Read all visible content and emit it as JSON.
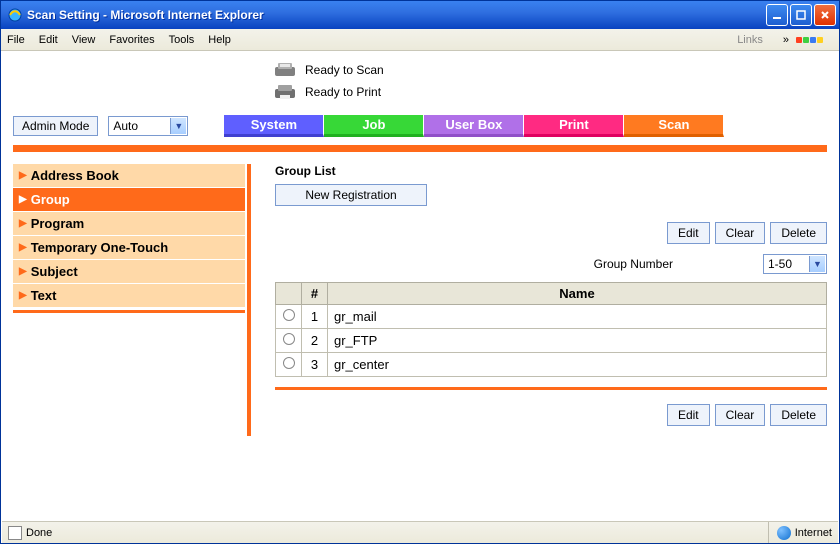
{
  "window": {
    "title": "Scan Setting - Microsoft Internet Explorer"
  },
  "menu": {
    "items": [
      "File",
      "Edit",
      "View",
      "Favorites",
      "Tools",
      "Help"
    ],
    "links_label": "Links"
  },
  "status_lines": {
    "scan": "Ready to Scan",
    "print": "Ready to Print"
  },
  "controls": {
    "admin_mode": "Admin Mode",
    "auto_option": "Auto"
  },
  "tabs": {
    "system": "System",
    "job": "Job",
    "userbox": "User Box",
    "print": "Print",
    "scan": "Scan"
  },
  "sidebar": {
    "items": [
      {
        "label": "Address Book"
      },
      {
        "label": "Group"
      },
      {
        "label": "Program"
      },
      {
        "label": "Temporary One-Touch"
      },
      {
        "label": "Subject"
      },
      {
        "label": "Text"
      }
    ],
    "active_index": 1
  },
  "group_panel": {
    "title": "Group List",
    "new_registration": "New Registration",
    "buttons": {
      "edit": "Edit",
      "clear": "Clear",
      "delete": "Delete"
    },
    "group_number_label": "Group Number",
    "group_number_value": "1-50",
    "columns": {
      "num": "#",
      "name": "Name"
    },
    "rows": [
      {
        "num": "1",
        "name": "gr_mail"
      },
      {
        "num": "2",
        "name": "gr_FTP"
      },
      {
        "num": "3",
        "name": "gr_center"
      }
    ]
  },
  "statusbar": {
    "done": "Done",
    "zone": "Internet"
  }
}
